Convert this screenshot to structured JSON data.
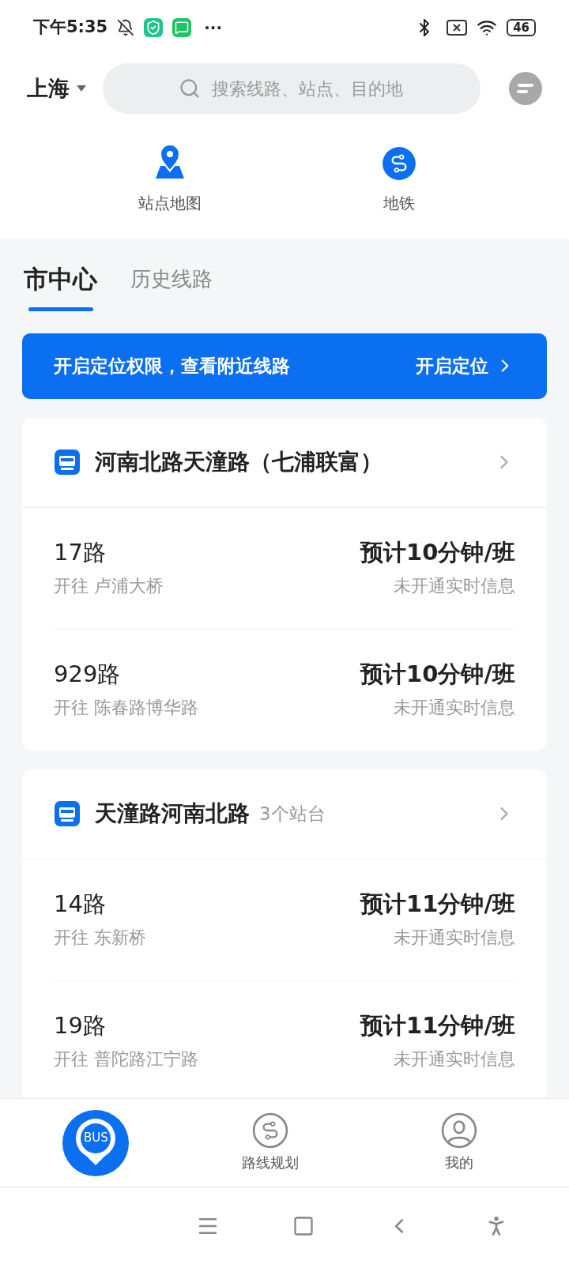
{
  "status_bar": {
    "time": "下午5:35",
    "more": "···",
    "battery": "46"
  },
  "header": {
    "city": "上海",
    "search": {
      "placeholder": "搜索线路、站点、目的地"
    }
  },
  "shortcuts": [
    {
      "kind": "map",
      "label": "站点地图"
    },
    {
      "kind": "metro",
      "label": "地铁"
    }
  ],
  "tabs": [
    {
      "label": "市中心",
      "selected": true
    },
    {
      "label": "历史线路",
      "selected": false
    }
  ],
  "banner": {
    "text": "开启定位权限，查看附近线路",
    "action": "开启定位"
  },
  "stations": [
    {
      "name": "河南北路天潼路（七浦联富）",
      "routes": [
        {
          "name": "17路",
          "direction": "开往 卢浦大桥",
          "eta": "预计10分钟/班",
          "realtime": "未开通实时信息"
        },
        {
          "name": "929路",
          "direction": "开往 陈春路博华路",
          "eta": "预计10分钟/班",
          "realtime": "未开通实时信息"
        }
      ]
    },
    {
      "name": "天潼路河南北路",
      "note": "3个站台",
      "routes": [
        {
          "name": "14路",
          "direction": "开往 东新桥",
          "eta": "预计11分钟/班",
          "realtime": "未开通实时信息"
        },
        {
          "name": "19路",
          "direction": "开往 普陀路江宁路",
          "eta": "预计11分钟/班",
          "realtime": "未开通实时信息"
        }
      ]
    }
  ],
  "bottom_nav": [
    {
      "kind": "bus",
      "label": "BUS",
      "selected": true
    },
    {
      "kind": "route",
      "label": "路线规划",
      "selected": false
    },
    {
      "kind": "me",
      "label": "我的",
      "selected": false
    }
  ]
}
